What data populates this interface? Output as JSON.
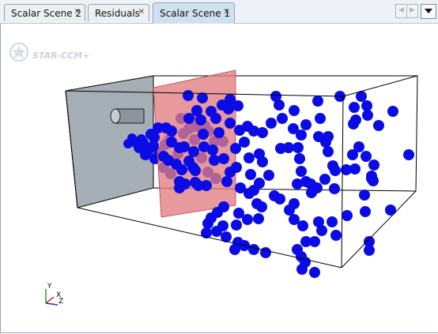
{
  "tabs": [
    {
      "label": "Scalar Scene 2",
      "close": "×",
      "active": false
    },
    {
      "label": "Residuals",
      "close": "×",
      "active": false
    },
    {
      "label": "Scalar Scene 1",
      "close": "×",
      "active": true
    }
  ],
  "nav": {
    "prev_icon": "◀",
    "next_icon": "▶",
    "dropdown_icon": "chevron-down-icon"
  },
  "watermark": {
    "text": "STAR-CCM+"
  },
  "axes": {
    "y": "Y",
    "x": "X",
    "z": "Z"
  },
  "colors": {
    "particle": "#0b0be6",
    "inlet_plane": "#9fa7b0",
    "section_plane": "#e79294",
    "tab_active": "#cfe0ee",
    "axis_y": "#2e9a2e",
    "axis_x": "#d22a2a",
    "axis_z": "#2a2ad2"
  },
  "particles_front": [
    [
      161,
      152,
      6
    ],
    [
      171,
      150,
      7
    ],
    [
      180,
      151,
      7
    ],
    [
      178,
      146,
      6
    ],
    [
      166,
      145,
      6
    ],
    [
      175,
      157,
      7
    ],
    [
      186,
      160,
      7
    ],
    [
      183,
      166,
      7
    ],
    [
      194,
      144,
      7
    ],
    [
      199,
      132,
      7
    ],
    [
      190,
      140,
      7
    ],
    [
      193,
      155,
      7
    ],
    [
      209,
      132,
      7
    ],
    [
      216,
      136,
      7
    ],
    [
      216,
      150,
      7
    ],
    [
      206,
      168,
      7
    ],
    [
      212,
      173,
      7
    ],
    [
      222,
      178,
      7
    ],
    [
      229,
      185,
      7
    ],
    [
      238,
      174,
      7
    ],
    [
      246,
      186,
      7
    ],
    [
      244,
      162,
      7
    ],
    [
      232,
      156,
      7
    ],
    [
      226,
      157,
      7
    ],
    [
      238,
      120,
      7
    ],
    [
      248,
      110,
      7
    ],
    [
      253,
      122,
      7
    ],
    [
      266,
      111,
      7
    ],
    [
      280,
      103,
      7
    ],
    [
      290,
      96,
      7
    ],
    [
      255,
      94,
      7
    ],
    [
      237,
      91,
      7
    ],
    [
      272,
      120,
      7
    ],
    [
      288,
      108,
      7
    ],
    [
      276,
      138,
      7
    ],
    [
      268,
      160,
      7
    ],
    [
      257,
      156,
      7
    ],
    [
      270,
      173,
      7
    ],
    [
      282,
      171,
      7
    ],
    [
      297,
      158,
      7
    ],
    [
      298,
      182,
      7
    ],
    [
      290,
      188,
      7
    ],
    [
      286,
      200,
      7
    ],
    [
      260,
      205,
      7
    ],
    [
      233,
      203,
      7
    ],
    [
      246,
      201,
      7
    ],
    [
      226,
      200,
      7
    ],
    [
      300,
      104,
      7
    ],
    [
      302,
      135,
      7
    ],
    [
      308,
      150,
      7
    ],
    [
      312,
      130,
      7
    ],
    [
      320,
      136,
      7
    ],
    [
      331,
      138,
      7
    ],
    [
      342,
      126,
      7
    ],
    [
      356,
      120,
      7
    ],
    [
      352,
      103,
      7
    ],
    [
      348,
      92,
      7
    ],
    [
      371,
      110,
      7
    ],
    [
      386,
      128,
      7
    ],
    [
      370,
      133,
      7
    ],
    [
      364,
      157,
      7
    ],
    [
      354,
      158,
      7
    ],
    [
      376,
      157,
      7
    ],
    [
      378,
      171,
      7
    ],
    [
      380,
      187,
      7
    ],
    [
      392,
      203,
      7
    ],
    [
      400,
      208,
      7
    ],
    [
      393,
      214,
      7
    ],
    [
      386,
      200,
      7
    ],
    [
      410,
      197,
      7
    ],
    [
      422,
      209,
      7
    ],
    [
      402,
      143,
      7
    ],
    [
      411,
      150,
      7
    ],
    [
      414,
      162,
      7
    ],
    [
      404,
      120,
      7
    ],
    [
      401,
      98,
      7
    ],
    [
      429,
      92,
      7
    ],
    [
      447,
      106,
      7
    ],
    [
      449,
      122,
      7
    ],
    [
      464,
      116,
      7
    ],
    [
      478,
      129,
      7
    ],
    [
      496,
      111,
      7
    ],
    [
      463,
      104,
      7
    ],
    [
      456,
      92,
      7
    ],
    [
      446,
      127,
      7
    ],
    [
      453,
      156,
      7
    ],
    [
      445,
      166,
      7
    ],
    [
      448,
      184,
      7
    ],
    [
      462,
      168,
      7
    ],
    [
      469,
      193,
      7
    ],
    [
      472,
      179,
      7
    ],
    [
      516,
      166,
      7
    ],
    [
      493,
      236,
      7
    ],
    [
      461,
      238,
      7
    ],
    [
      466,
      276,
      7
    ],
    [
      466,
      287,
      7
    ],
    [
      438,
      243,
      7
    ],
    [
      419,
      251,
      7
    ],
    [
      424,
      268,
      7
    ],
    [
      402,
      251,
      7
    ],
    [
      406,
      262,
      7
    ],
    [
      397,
      276,
      7
    ],
    [
      382,
      256,
      7
    ],
    [
      386,
      276,
      7
    ],
    [
      375,
      286,
      7
    ],
    [
      380,
      295,
      7
    ],
    [
      385,
      302,
      7
    ],
    [
      381,
      311,
      7
    ],
    [
      397,
      315,
      7
    ],
    [
      371,
      228,
      7
    ],
    [
      371,
      248,
      7
    ],
    [
      353,
      222,
      7
    ],
    [
      346,
      218,
      7
    ],
    [
      330,
      232,
      7
    ],
    [
      324,
      228,
      7
    ],
    [
      320,
      211,
      7
    ],
    [
      314,
      215,
      7
    ],
    [
      326,
      247,
      7
    ],
    [
      312,
      248,
      7
    ],
    [
      301,
      240,
      7
    ],
    [
      298,
      255,
      7
    ],
    [
      281,
      256,
      7
    ],
    [
      282,
      232,
      7
    ],
    [
      274,
      239,
      7
    ],
    [
      266,
      246,
      7
    ],
    [
      262,
      253,
      7
    ],
    [
      260,
      265,
      7
    ],
    [
      273,
      263,
      7
    ],
    [
      285,
      270,
      7
    ],
    [
      300,
      277,
      7
    ],
    [
      308,
      281,
      7
    ],
    [
      296,
      286,
      7
    ],
    [
      320,
      286,
      7
    ],
    [
      335,
      290,
      7
    ],
    [
      331,
      175,
      7
    ],
    [
      339,
      192,
      7
    ],
    [
      327,
      202,
      7
    ],
    [
      316,
      191,
      7
    ],
    [
      303,
      208,
      7
    ],
    [
      314,
      170,
      7
    ],
    [
      327,
      165,
      7
    ],
    [
      290,
      126,
      7
    ],
    [
      256,
      140,
      7
    ],
    [
      250,
      205,
      7
    ],
    [
      243,
      182,
      7
    ],
    [
      226,
      208,
      7
    ],
    [
      420,
      180,
      7
    ],
    [
      375,
      203,
      7
    ],
    [
      380,
      141,
      7
    ],
    [
      414,
      143,
      7
    ],
    [
      437,
      185,
      7
    ],
    [
      423,
      186,
      7
    ],
    [
      460,
      217,
      7
    ],
    [
      471,
      199,
      7
    ],
    [
      469,
      196,
      7
    ],
    [
      365,
      236,
      7
    ]
  ],
  "particles_back": [
    [
      228,
      120,
      7
    ],
    [
      214,
      146,
      7
    ],
    [
      201,
      163,
      7
    ],
    [
      206,
      182,
      7
    ],
    [
      231,
      139,
      7
    ],
    [
      245,
      147,
      7
    ],
    [
      254,
      170,
      7
    ],
    [
      262,
      188,
      7
    ],
    [
      272,
      196,
      7
    ],
    [
      224,
      165,
      7
    ],
    [
      208,
      153,
      7
    ],
    [
      195,
      171,
      7
    ],
    [
      215,
      190,
      7
    ],
    [
      238,
      133,
      7
    ],
    [
      247,
      130,
      7
    ],
    [
      263,
      136,
      7
    ],
    [
      281,
      149,
      7
    ],
    [
      270,
      149,
      7
    ],
    [
      248,
      116,
      7
    ],
    [
      258,
      129,
      7
    ]
  ]
}
